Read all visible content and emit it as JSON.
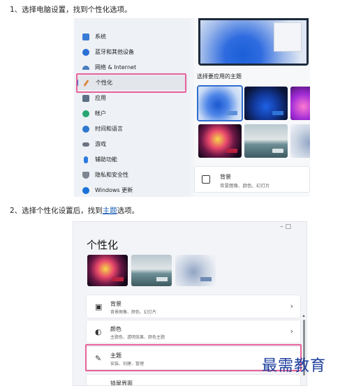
{
  "step1": {
    "text": "1、选择电脑设置，找到个性化选项。"
  },
  "step2": {
    "prefix": "2、选择个性化设置后，找到",
    "link": "主题",
    "suffix": "选项。"
  },
  "settings1": {
    "sidebar": [
      {
        "label": "系统",
        "icon": "monitor-icon",
        "color": "#3a7bd5"
      },
      {
        "label": "蓝牙和其他设备",
        "icon": "bluetooth-icon",
        "color": "#2b6fd6"
      },
      {
        "label": "网络 & Internet",
        "icon": "wifi-icon",
        "color": "#4a7cc0"
      },
      {
        "label": "个性化",
        "icon": "brush-icon",
        "color": "#d98a3a",
        "active": true
      },
      {
        "label": "应用",
        "icon": "apps-icon",
        "color": "#5c6f86"
      },
      {
        "label": "帐户",
        "icon": "account-icon",
        "color": "#27a673"
      },
      {
        "label": "时间和语言",
        "icon": "clock-icon",
        "color": "#2f78d0"
      },
      {
        "label": "游戏",
        "icon": "gamepad-icon",
        "color": "#6b7480"
      },
      {
        "label": "辅助功能",
        "icon": "accessibility-icon",
        "color": "#2a7ae0"
      },
      {
        "label": "隐私和安全性",
        "icon": "shield-icon",
        "color": "#7d8691"
      },
      {
        "label": "Windows 更新",
        "icon": "update-icon",
        "color": "#1a73d8"
      }
    ],
    "theme_title": "选择要应用的主题",
    "background": {
      "title": "背景",
      "subtitle": "背景图像、颜色、幻灯片"
    }
  },
  "settings2": {
    "window_controls": "–   ▢",
    "page_title": "个性化",
    "rows": [
      {
        "title": "背景",
        "subtitle": "背景图像、颜色、幻灯片",
        "icon": "image-icon",
        "glyph": "▣"
      },
      {
        "title": "颜色",
        "subtitle": "主题色、透明效果、颜色主题",
        "icon": "palette-icon",
        "glyph": "◐"
      },
      {
        "title": "主题",
        "subtitle": "安装、创建、管理",
        "icon": "pen-icon",
        "glyph": "✎"
      },
      {
        "title": "锁屏界面",
        "subtitle": "",
        "icon": "lockscreen-icon",
        "glyph": "▭"
      }
    ],
    "chevron": "›"
  },
  "watermark": "最需教育"
}
